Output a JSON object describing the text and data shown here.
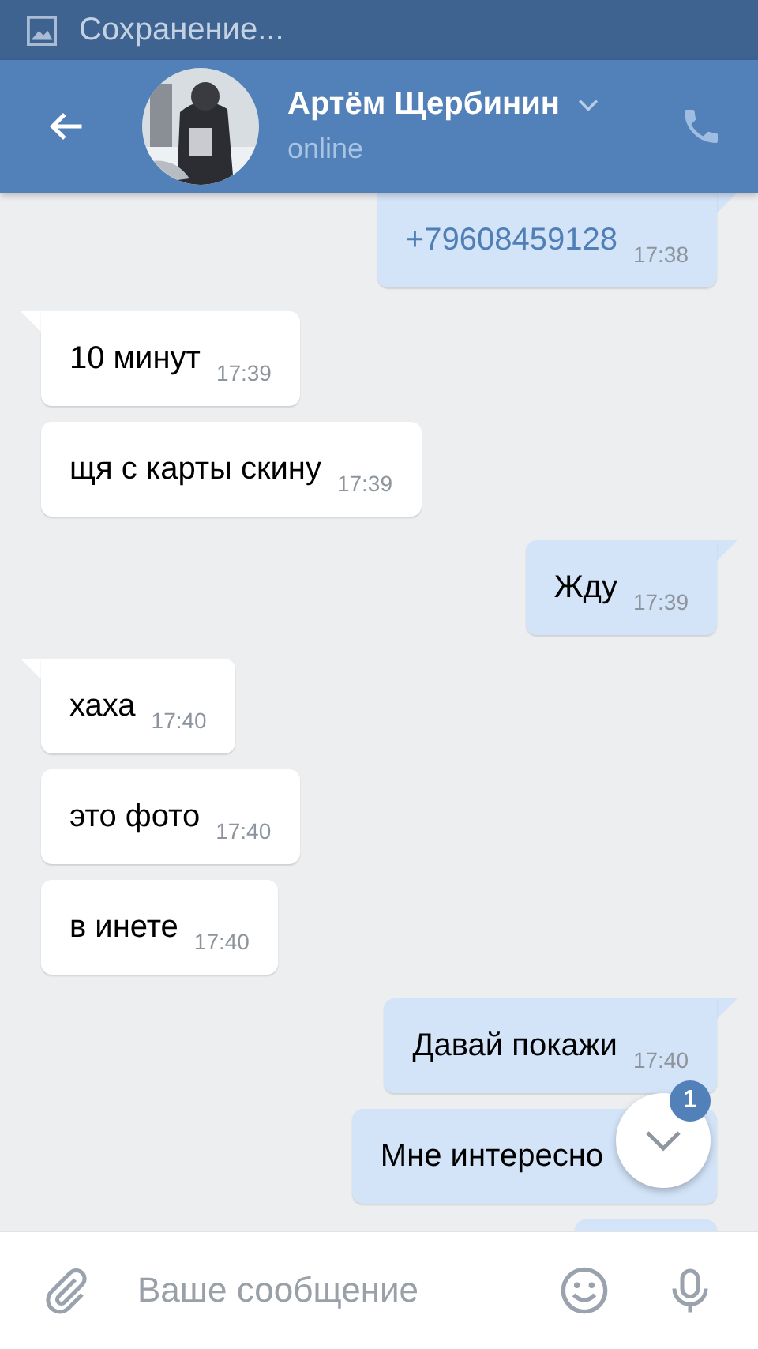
{
  "status_bar": {
    "notification": "Сохранение..."
  },
  "header": {
    "contact_name": "Артём Щербинин",
    "status": "online"
  },
  "messages": [
    {
      "kind": "outgoing",
      "text": "+79608459128",
      "time": "17:38",
      "link": true,
      "tail": true
    },
    {
      "kind": "incoming",
      "text": "10 минут",
      "time": "17:39",
      "link": false,
      "tail": true
    },
    {
      "kind": "incoming",
      "text": "щя с карты скину",
      "time": "17:39",
      "link": false,
      "tail": false
    },
    {
      "kind": "outgoing",
      "text": "Жду",
      "time": "17:39",
      "link": false,
      "tail": true
    },
    {
      "kind": "incoming",
      "text": "хаха",
      "time": "17:40",
      "link": false,
      "tail": true
    },
    {
      "kind": "incoming",
      "text": "это фото",
      "time": "17:40",
      "link": false,
      "tail": false
    },
    {
      "kind": "incoming",
      "text": "в инете",
      "time": "17:40",
      "link": false,
      "tail": false
    },
    {
      "kind": "outgoing",
      "text": "Давай покажи",
      "time": "17:40",
      "link": false,
      "tail": true
    },
    {
      "kind": "outgoing",
      "text": "Мне интересно",
      "link": false,
      "tail": false
    },
    {
      "kind": "outgoing",
      "tail": false
    }
  ],
  "scroll_button": {
    "badge": "1"
  },
  "composer": {
    "placeholder": "Ваше сообщение"
  }
}
